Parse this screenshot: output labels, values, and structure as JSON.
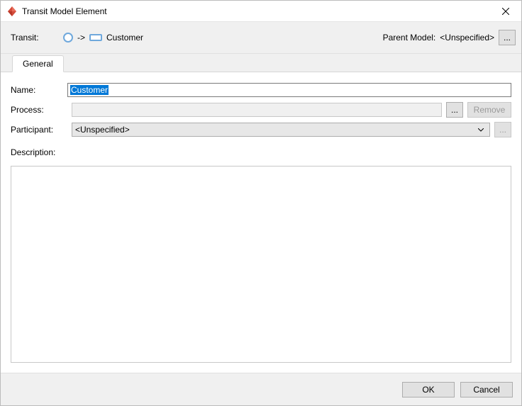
{
  "window": {
    "title": "Transit Model Element"
  },
  "topband": {
    "transit_label": "Transit:",
    "arrow": "->",
    "target_name": "Customer",
    "parent_model_label": "Parent Model:",
    "parent_model_value": "<Unspecified>",
    "ellipsis": "..."
  },
  "tab": {
    "general": "General"
  },
  "form": {
    "name_label": "Name:",
    "name_value": "Customer",
    "process_label": "Process:",
    "process_value": "",
    "process_ellipsis": "...",
    "remove_label": "Remove",
    "participant_label": "Participant:",
    "participant_value": "<Unspecified>",
    "participant_ellipsis": "...",
    "description_label": "Description:",
    "description_value": ""
  },
  "footer": {
    "ok": "OK",
    "cancel": "Cancel"
  }
}
